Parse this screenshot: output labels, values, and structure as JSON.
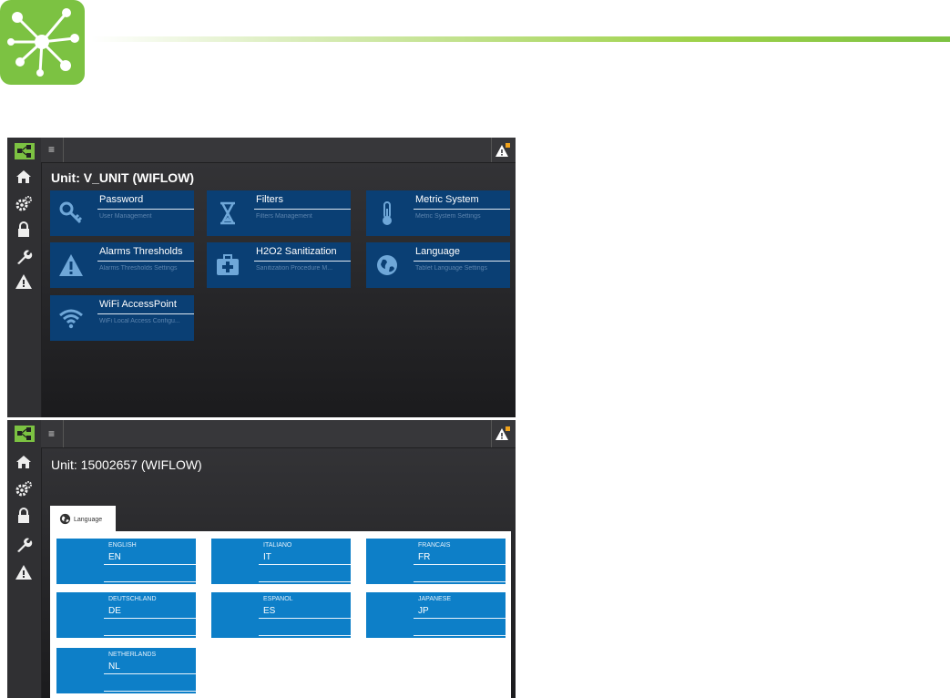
{
  "colors": {
    "brand_green": "#7cc242",
    "tile_blue": "#0a3f74",
    "lang_blue": "#0d7fc8"
  },
  "screen1": {
    "menu_icon": "hamburger-icon",
    "unit_title": "Unit: V_UNIT (WIFLOW)",
    "sidebar": [
      "home-icon",
      "gears-icon",
      "lock-icon",
      "wrench-icon",
      "warning-icon"
    ],
    "tiles": [
      {
        "name": "Password",
        "desc": "User Management",
        "icon": "key-icon"
      },
      {
        "name": "Filters",
        "desc": "Filters Management",
        "icon": "hourglass-icon"
      },
      {
        "name": "Metric System",
        "desc": "Metric System Settings",
        "icon": "thermometer-icon"
      },
      {
        "name": "Alarms Thresholds",
        "desc": "Alarms Thresholds Settings",
        "icon": "warning-icon"
      },
      {
        "name": "H2O2 Sanitization",
        "desc": "Sanitization Procedure M...",
        "icon": "medical-kit-icon"
      },
      {
        "name": "Language",
        "desc": "Tablet Language Settings",
        "icon": "globe-icon"
      },
      {
        "name": "WiFi AccessPoint",
        "desc": "WiFi Local Access Configu...",
        "icon": "wifi-icon"
      }
    ]
  },
  "screen2": {
    "unit_title": "Unit: 15002657 (WIFLOW)",
    "tab_label": "Language",
    "languages": [
      {
        "name": "ENGLISH",
        "code": "EN"
      },
      {
        "name": "ITALIANO",
        "code": "IT"
      },
      {
        "name": "FRANCAIS",
        "code": "FR"
      },
      {
        "name": "DEUTSCHLAND",
        "code": "DE"
      },
      {
        "name": "ESPANOL",
        "code": "ES"
      },
      {
        "name": "JAPANESE",
        "code": "JP"
      },
      {
        "name": "NETHERLANDS",
        "code": "NL"
      }
    ]
  }
}
